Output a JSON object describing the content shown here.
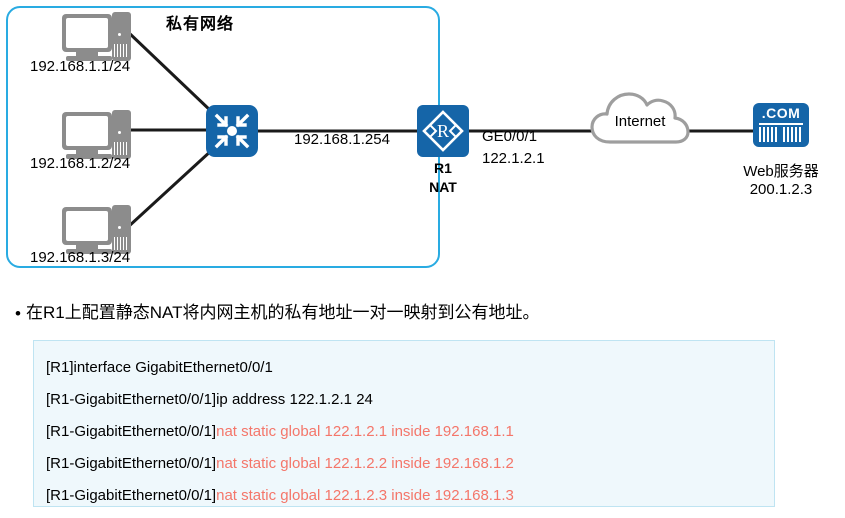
{
  "diagram": {
    "private_network": {
      "title": "私有网络",
      "border_color": "#29ABE2"
    },
    "hosts": [
      {
        "name": "pc-1",
        "label": "192.168.1.1/24"
      },
      {
        "name": "pc-2",
        "label": "192.168.1.2/24"
      },
      {
        "name": "pc-3",
        "label": "192.168.1.3/24"
      }
    ],
    "switch": {
      "icon": "switch-icon",
      "color": "#1565a8"
    },
    "router": {
      "icon": "router-icon",
      "glyph": "R",
      "name": "R1",
      "role": "NAT",
      "color": "#1565a8"
    },
    "links": {
      "lan_gateway": "192.168.1.254",
      "wan_interface": "GE0/0/1",
      "wan_address": "122.1.2.1"
    },
    "internet": {
      "label": "Internet",
      "outline_color": "#9e9e9e"
    },
    "web_server": {
      "icon": "web-server-icon",
      "badge": ".COM",
      "label": "Web服务器",
      "address": "200.1.2.3",
      "color": "#1565a8"
    }
  },
  "bullet": {
    "marker": "•",
    "text": "在R1上配置静态NAT将内网主机的私有地址一对一映射到公有地址。"
  },
  "code": {
    "background": "#EFF8FC",
    "border": "#BFE4F2",
    "highlight_color": "#F4766A",
    "lines": [
      {
        "prompt": "[R1]interface GigabitEthernet0/0/1",
        "command": ""
      },
      {
        "prompt": "[R1-GigabitEthernet0/0/1]ip address 122.1.2.1 24",
        "command": ""
      },
      {
        "prompt": "[R1-GigabitEthernet0/0/1]",
        "command": "nat static global 122.1.2.1 inside 192.168.1.1"
      },
      {
        "prompt": "[R1-GigabitEthernet0/0/1]",
        "command": "nat static global 122.1.2.2 inside 192.168.1.2"
      },
      {
        "prompt": "[R1-GigabitEthernet0/0/1]",
        "command": "nat static global 122.1.2.3 inside 192.168.1.3"
      }
    ]
  }
}
